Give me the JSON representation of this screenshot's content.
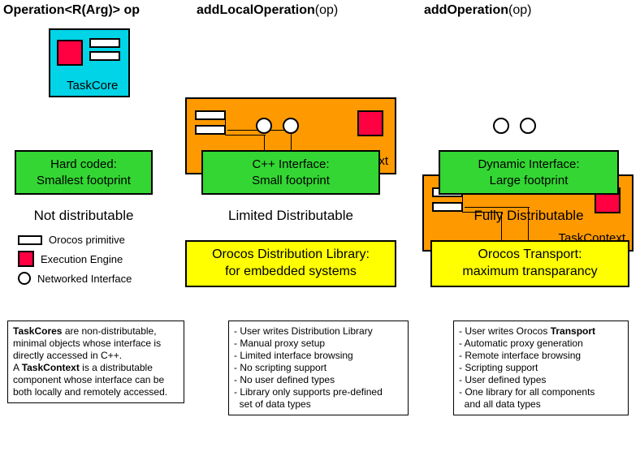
{
  "headers": {
    "col1": {
      "bold": "Operation<R(Arg)> op"
    },
    "col2": {
      "bold": "addLocalOperation",
      "light": "(op)"
    },
    "col3": {
      "bold": "addOperation",
      "light": "(op)"
    }
  },
  "boxLabels": {
    "taskCore": "TaskCore",
    "taskContext1": "TaskContext",
    "taskContext2": "TaskContext"
  },
  "green": {
    "col1": {
      "l1": "Hard coded:",
      "l2": "Smallest footprint"
    },
    "col2": {
      "l1": "C++ Interface:",
      "l2": "Small footprint"
    },
    "col3": {
      "l1": "Dynamic Interface:",
      "l2": "Large footprint"
    }
  },
  "dist": {
    "col1": "Not distributable",
    "col2": "Limited Distributable",
    "col3": "Fully Distributable"
  },
  "yellow": {
    "col2": {
      "l1": "Orocos Distribution Library:",
      "l2": "for embedded systems"
    },
    "col3": {
      "l1": "Orocos Transport:",
      "l2": "maximum transparancy"
    }
  },
  "legend": {
    "prim": "Orocos primitive",
    "exec": "Execution Engine",
    "net": "Networked Interface"
  },
  "notes": {
    "col1": {
      "b1": "TaskCores",
      "t1": " are non-distributable, minimal objects whose interface is directly accessed in C++.",
      "t2": "A ",
      "b2": "TaskContext",
      "t3": " is a distributable component whose interface can be both locally and remotely accessed."
    },
    "col2": {
      "i1": "- User writes Distribution Library",
      "i2": "- Manual proxy setup",
      "i3": "- Limited interface browsing",
      "i4": "- No scripting support",
      "i5": "- No user defined types",
      "i6": "- Library only supports pre-defined",
      "i7": "  set of data types"
    },
    "col3": {
      "p1": "- User writes Orocos ",
      "b1": "Transport",
      "i2": "- Automatic proxy generation",
      "i3": "- Remote interface browsing",
      "i4": "- Scripting support",
      "i5": "- User defined types",
      "i6": "- One library for all components",
      "i7": "  and all data types"
    }
  }
}
